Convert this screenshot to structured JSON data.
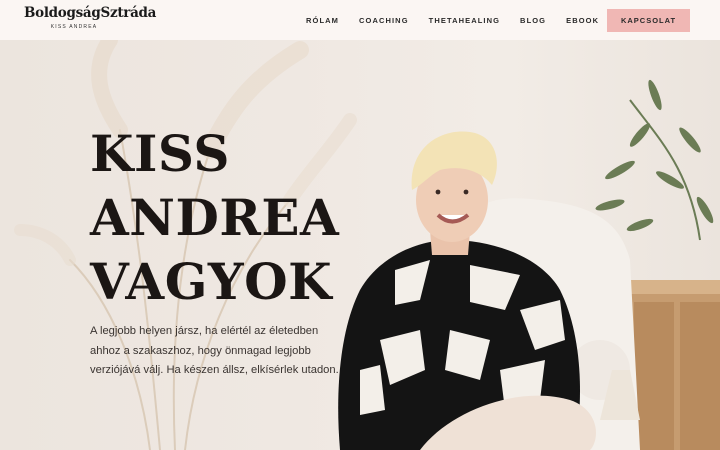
{
  "brand": {
    "logo_text": "BoldogságSztráda",
    "logo_subtitle": "KISS ANDREA"
  },
  "nav": {
    "items": [
      "RÓLAM",
      "COACHING",
      "THETAHEALING",
      "BLOG",
      "EBOOK"
    ],
    "cta_label": "KAPCSOLAT"
  },
  "hero": {
    "headline": [
      "KISS",
      "ANDREA",
      "VAGYOK"
    ],
    "tagline": "A legjobb helyen jársz, ha elértél az életedben ahhoz a szakaszhoz, hogy önmagad legjobb verziójává válj. Ha készen állsz, elkísérlek utadon."
  },
  "colors": {
    "accent": "#f0b7b4",
    "header_bg": "#fbf6f3",
    "text_dark": "#1b1614"
  }
}
